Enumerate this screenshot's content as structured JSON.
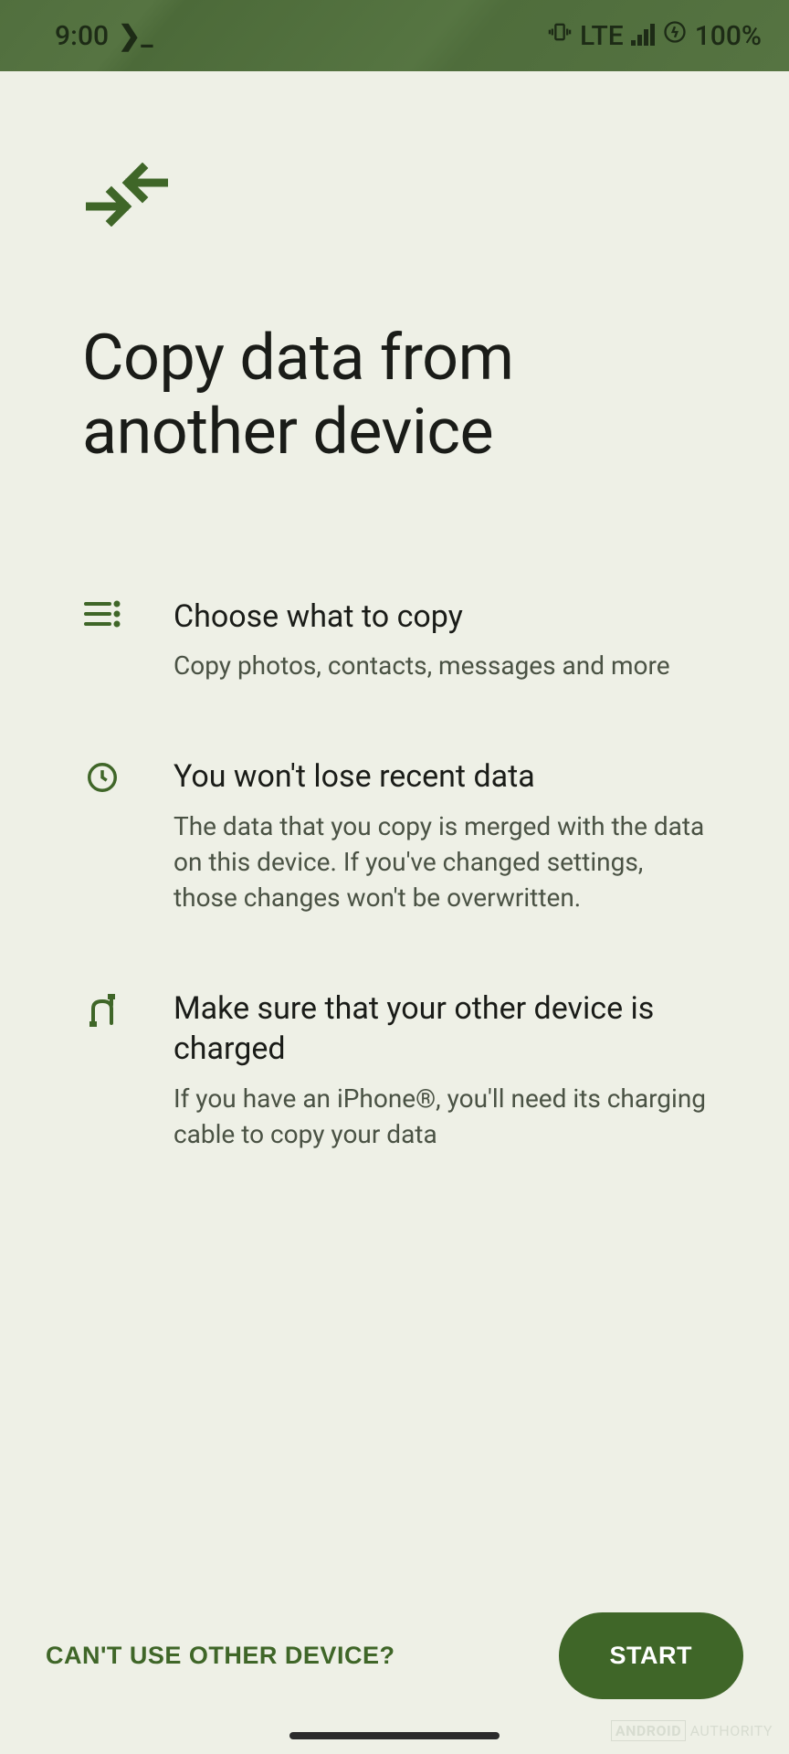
{
  "status": {
    "time": "9:00",
    "terminal_glyph": "❯_",
    "vibrate_glyph": "📳",
    "network": "LTE",
    "battery": "100%"
  },
  "page": {
    "title": "Copy data from another device"
  },
  "items": [
    {
      "title": "Choose what to copy",
      "desc": "Copy photos, contacts, messages and more"
    },
    {
      "title": "You won't lose recent data",
      "desc": "The data that you copy is merged with the data on this device. If you've changed settings, those changes won't be overwritten."
    },
    {
      "title": "Make sure that your other device is charged",
      "desc": "If you have an iPhone®, you'll need its charging cable to copy your data"
    }
  ],
  "footer": {
    "secondary": "CAN'T USE OTHER DEVICE?",
    "primary": "START"
  },
  "watermark": {
    "brand": "ANDROID",
    "site": "AUTHORITY"
  }
}
